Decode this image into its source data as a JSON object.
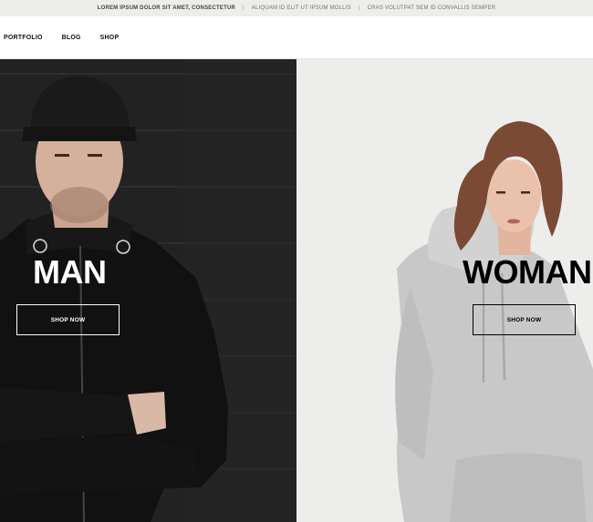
{
  "topbar": {
    "items": [
      "LOREM IPSUM DOLOR SIT AMET, CONSECTETUR",
      "ALIQUAM ID ELIT UT IPSUM MOLLIS",
      "CRAS VOLUTPAT SEM ID CONVALLIS SEMPER"
    ],
    "separator": "|"
  },
  "nav": {
    "items": [
      "PORTFOLIO",
      "BLOG",
      "SHOP"
    ]
  },
  "hero": {
    "man": {
      "title": "MAN",
      "button": "SHOP NOW"
    },
    "woman": {
      "title": "WOMAN",
      "button": "SHOP NOW"
    }
  },
  "colors": {
    "topbar_bg": "#ededeb",
    "man_bg": "#1e1e1e",
    "woman_bg": "#ededec"
  }
}
